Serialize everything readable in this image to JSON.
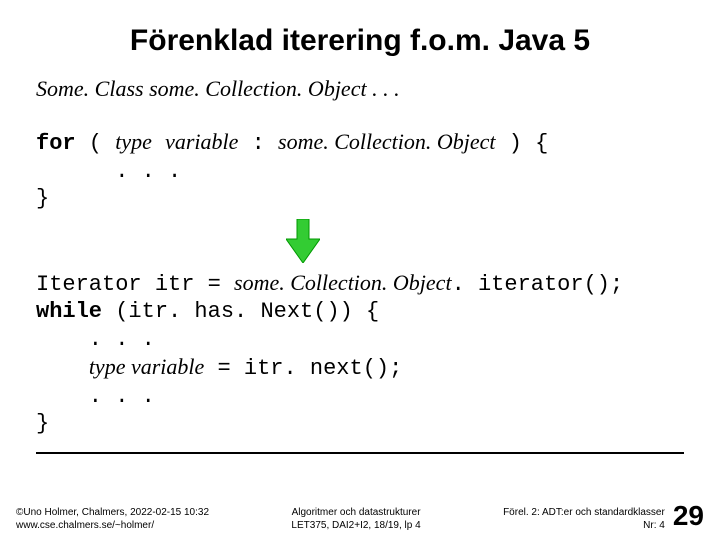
{
  "title": "Förenklad iterering f.o.m. Java 5",
  "decl_prefix": "Some. Class ",
  "decl_obj": "some. Collection. Object",
  "decl_suffix": " . . .",
  "code1": {
    "for": "for",
    "open": " ( ",
    "type": "type",
    "sp1": " ",
    "var": "variable",
    "colon": " : ",
    "obj": "some. Collection. Object",
    "close": " ) {",
    "dots": "      . . .",
    "brace": "}"
  },
  "code2": {
    "l1a": "Iterator itr = ",
    "l1b": "some. Collection. Object",
    "l1c": ". iterator();",
    "while": "while",
    "l2b": " (itr. has. Next()) {",
    "l3": "    . . .",
    "l4a": "    ",
    "l4b": "type variable",
    "l4c": " = itr. next();",
    "l5": "    . . .",
    "l6": "}"
  },
  "footer": {
    "left1": "©Uno Holmer, Chalmers, 2022-02-15 10:32",
    "left2": "www.cse.chalmers.se/~holmer/",
    "center1": "Algoritmer och datastrukturer",
    "center2": "LET375, DAI2+I2, 18/19, lp 4",
    "right1": "Förel. 2: ADT:er och standardklasser",
    "right2": "Nr: 4",
    "page": "29"
  }
}
